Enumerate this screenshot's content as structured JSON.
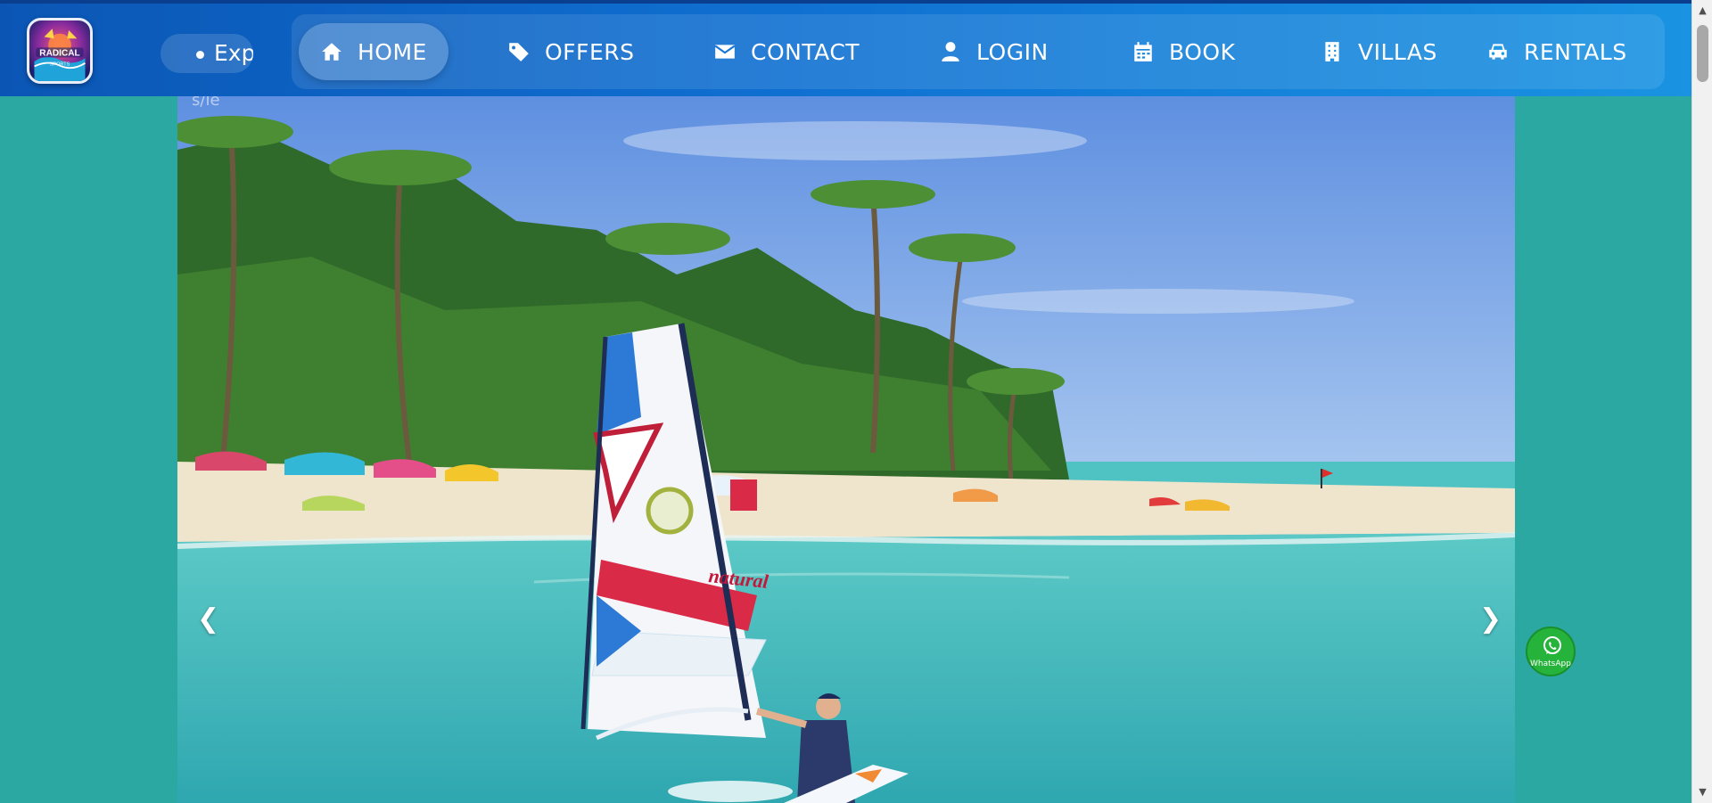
{
  "header": {
    "logo_alt": "Radical Sports",
    "ticker": {
      "text": "Exp"
    },
    "nav": [
      {
        "label": "HOME",
        "icon": "home-icon",
        "active": true
      },
      {
        "label": "OFFERS",
        "icon": "tag-icon"
      },
      {
        "label": "CONTACT",
        "icon": "envelope-icon"
      },
      {
        "label": "LOGIN",
        "icon": "user-icon"
      },
      {
        "label": "BOOK",
        "icon": "calendar-icon"
      },
      {
        "label": "VILLAS",
        "icon": "building-icon"
      },
      {
        "label": "RENTALS",
        "icon": "car-icon"
      }
    ]
  },
  "hero": {
    "caption_fragment": "s/le",
    "prev_arrow": "❮",
    "next_arrow": "❯",
    "sail_brand": "natural"
  },
  "whatsapp": {
    "label": "WhatsApp"
  },
  "scrollbar": {
    "up": "▲",
    "down": "▼"
  },
  "colors": {
    "page_bg": "#2aa8a1",
    "header_start": "#0b56b5",
    "header_end": "#1a93e2",
    "whatsapp": "#25b33b"
  }
}
